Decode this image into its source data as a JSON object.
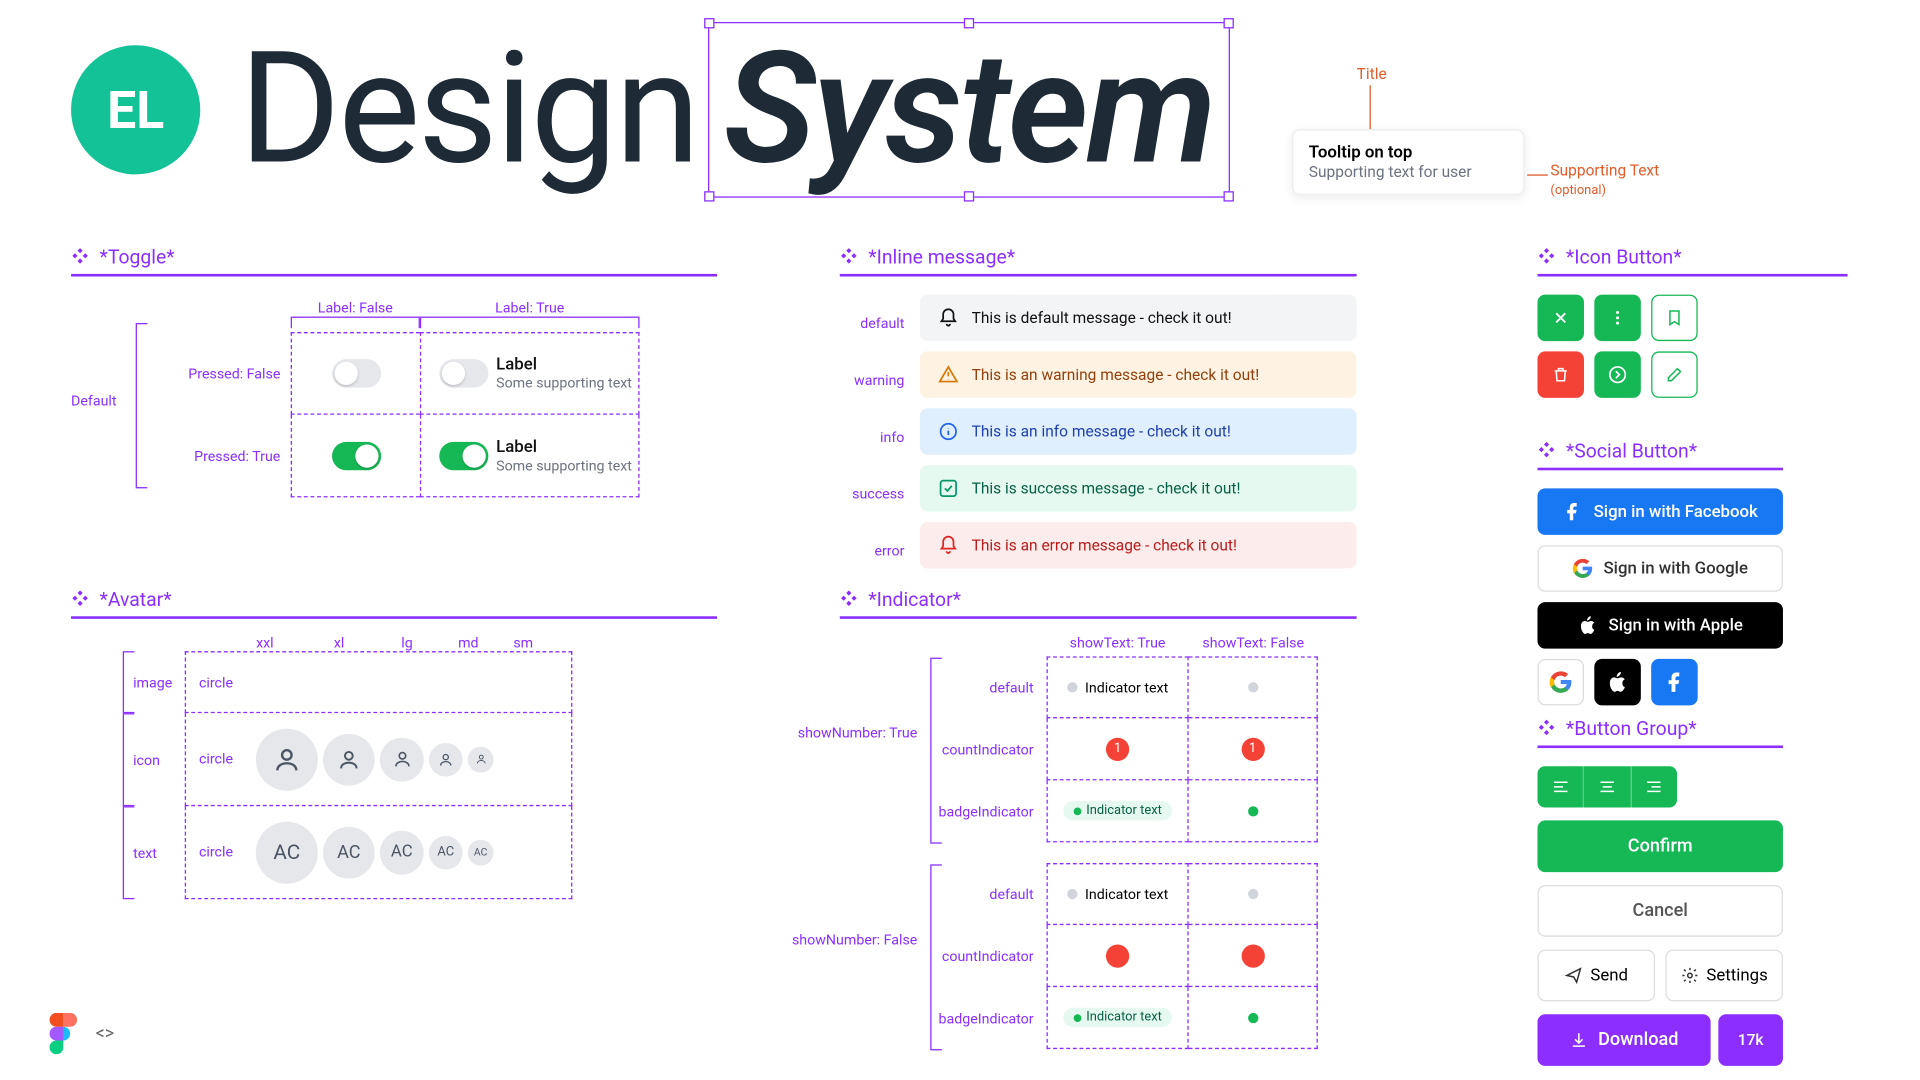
{
  "header": {
    "logo": "EL",
    "word1": "Design",
    "word2": "System",
    "tooltip_title": "Tooltip on top",
    "tooltip_sub": "Supporting text for user",
    "ann_title": "Title",
    "ann_sup": "Supporting Text",
    "ann_opt": "(optional)"
  },
  "toggle": {
    "title": "*Toggle*",
    "col_false": "Label: False",
    "col_true": "Label: True",
    "row_default": "Default",
    "row_pressed_false": "Pressed: False",
    "row_pressed_true": "Pressed: True",
    "label": "Label",
    "supporting": "Some supporting text"
  },
  "avatar": {
    "title": "*Avatar*",
    "sizes": [
      "xxl",
      "xl",
      "lg",
      "md",
      "sm"
    ],
    "rows": [
      "image",
      "icon",
      "text"
    ],
    "shape": "circle",
    "initials": "AC"
  },
  "inline": {
    "title": "*Inline message*",
    "rows": [
      {
        "label": "default",
        "cls": "msg-default",
        "text": "This is default message - check it out!"
      },
      {
        "label": "warning",
        "cls": "msg-warning",
        "text": "This is an warning message - check it out!"
      },
      {
        "label": "info",
        "cls": "msg-info",
        "text": "This is an info message - check it out!"
      },
      {
        "label": "success",
        "cls": "msg-success",
        "text": "This is success message - check it out!"
      },
      {
        "label": "error",
        "cls": "msg-error",
        "text": "This is an error message - check it out!"
      }
    ]
  },
  "indicator": {
    "title": "*Indicator*",
    "col_true": "showText: True",
    "col_false": "showText: False",
    "group_true": "showNumber: True",
    "group_false": "showNumber: False",
    "row_default": "default",
    "row_count": "countIndicator",
    "row_badge": "badgeIndicator",
    "text": "Indicator text",
    "count": "1"
  },
  "iconbtn": {
    "title": "*Icon Button*"
  },
  "social": {
    "title": "*Social Button*",
    "fb": "Sign in with Facebook",
    "gg": "Sign in with Google",
    "ap": "Sign in with Apple"
  },
  "btngroup": {
    "title": "*Button Group*",
    "confirm": "Confirm",
    "cancel": "Cancel",
    "send": "Send",
    "settings": "Settings",
    "download": "Download",
    "count": "17k"
  }
}
